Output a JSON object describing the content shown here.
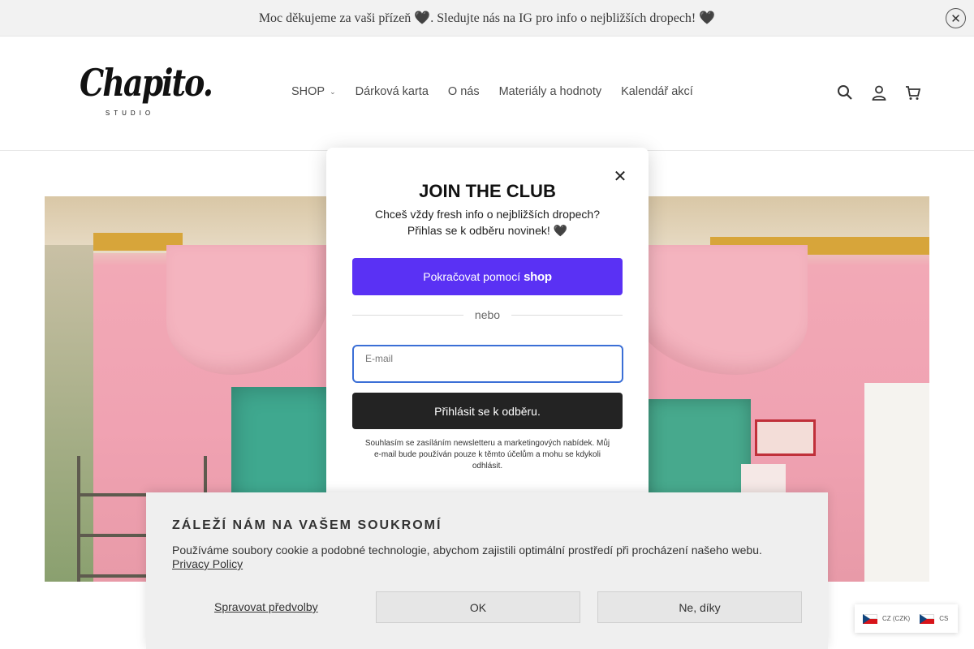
{
  "announcement": {
    "text": "Moc děkujeme za vaši přízeň 🖤. Sledujte nás na IG pro info o nejbližších dropech! 🖤",
    "close_icon": "close-circle-icon"
  },
  "header": {
    "logo_main": "Chapito.",
    "logo_sub": "STUDIO",
    "nav": [
      {
        "label": "SHOP",
        "has_dropdown": true
      },
      {
        "label": "Dárková karta"
      },
      {
        "label": "O nás"
      },
      {
        "label": "Materiály a hodnoty"
      },
      {
        "label": "Kalendář akcí"
      }
    ],
    "icons": [
      "search-icon",
      "account-icon",
      "cart-icon"
    ]
  },
  "modal": {
    "title": "JOIN THE CLUB",
    "subtitle": "Chceš vždy fresh info o nejbližších dropech? Přihlas se k odběru novinek! 🖤",
    "shop_button_prefix": "Pokračovat pomocí",
    "shop_button_brand": "shop",
    "divider": "nebo",
    "email_label": "E-mail",
    "email_value": "",
    "submit_label": "Přihlásit se k odběru.",
    "legal": "Souhlasím se zasíláním newsletteru a marketingových nabídek. Můj e-mail bude používán pouze k těmto účelům a mohu se kdykoli odhlásit.",
    "brand_color": "#5a31f4"
  },
  "cookie": {
    "title": "ZÁLEŽÍ NÁM NA VAŠEM SOUKROMÍ",
    "text": "Používáme soubory cookie a podobné technologie, abychom zajistili optimální prostředí při procházení našeho webu.",
    "privacy_link": "Privacy Policy",
    "manage": "Spravovat předvolby",
    "ok": "OK",
    "decline": "Ne, díky"
  },
  "currency": {
    "items": [
      {
        "label": "CZ (CZK)"
      },
      {
        "label": "CS"
      }
    ]
  }
}
